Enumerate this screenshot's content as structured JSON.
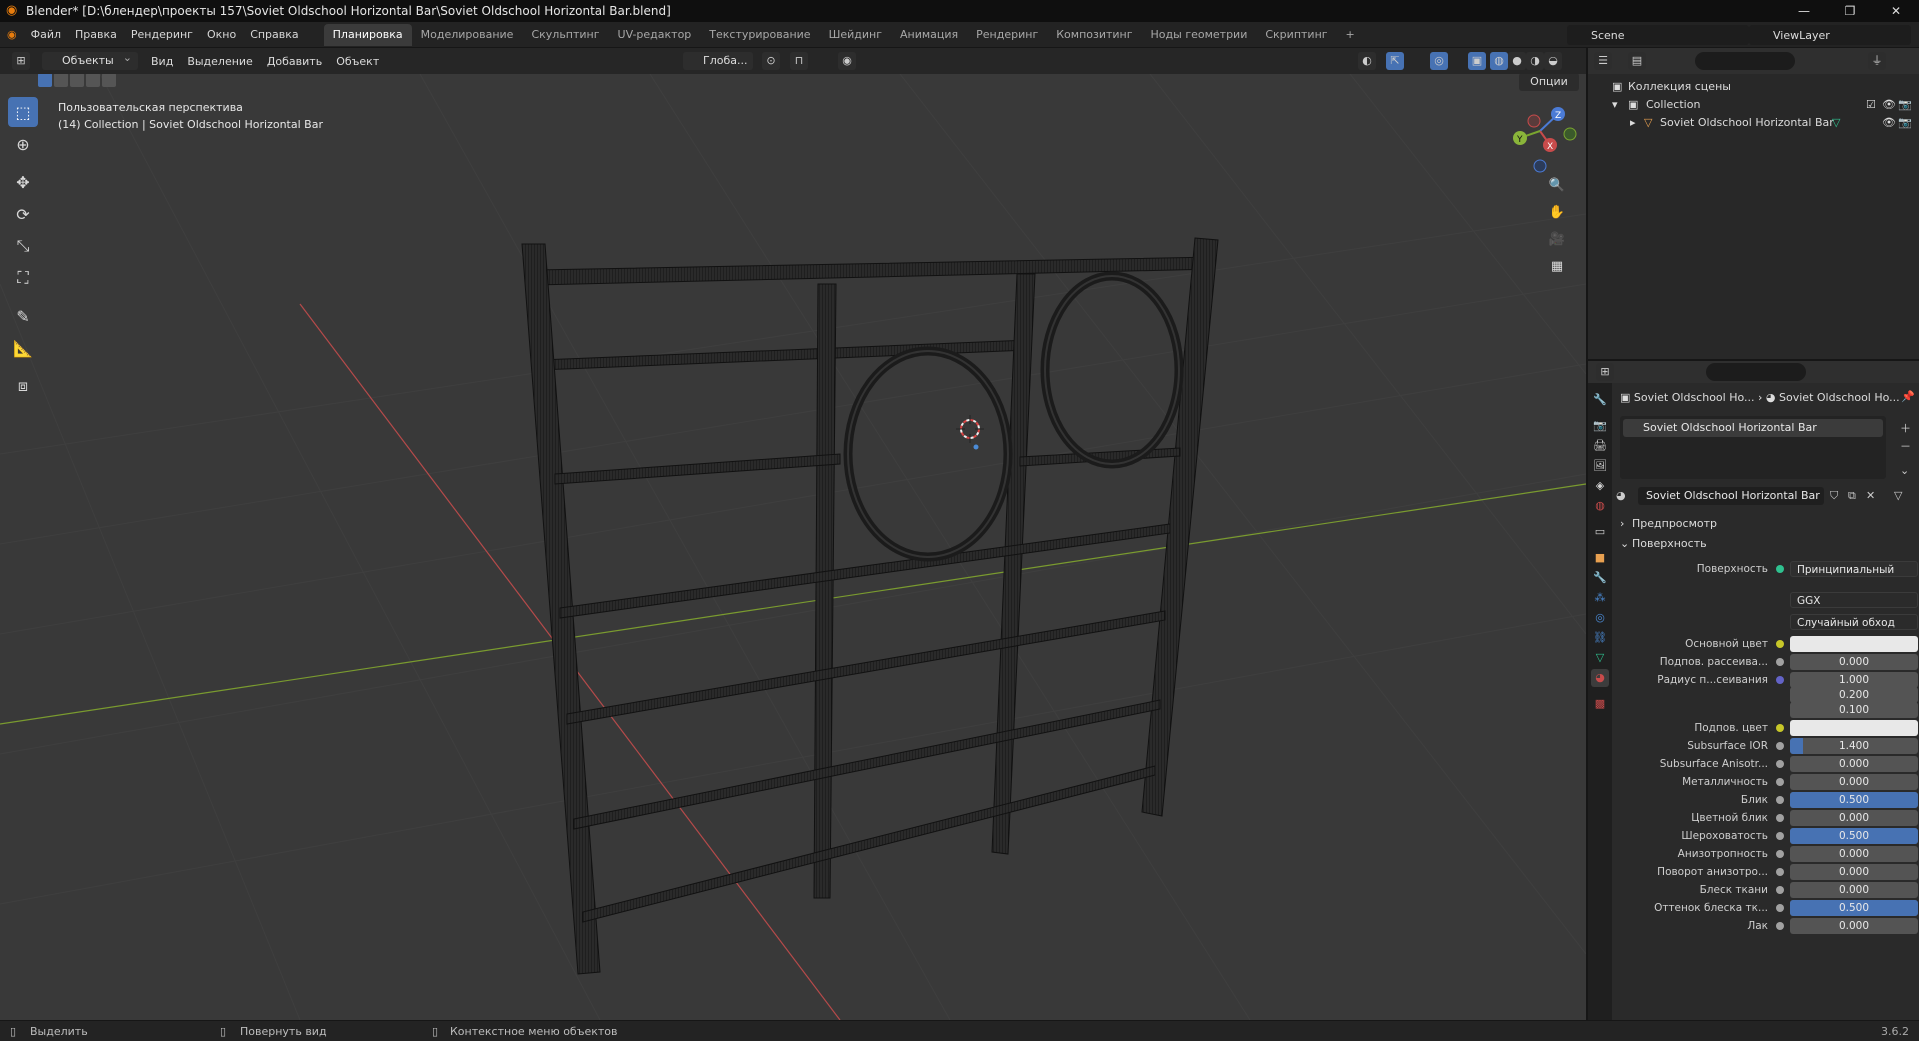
{
  "window": {
    "title": "Blender* [D:\\блендер\\проекты 157\\Soviet Oldschool Horizontal Bar\\Soviet Oldschool Horizontal Bar.blend]",
    "controls": [
      "—",
      "❐",
      "✕"
    ]
  },
  "menu": [
    "Файл",
    "Правка",
    "Рендеринг",
    "Окно",
    "Справка"
  ],
  "workspaces": [
    "Планировка",
    "Моделирование",
    "Скульптинг",
    "UV-редактор",
    "Текстурирование",
    "Шейдинг",
    "Анимация",
    "Рендеринг",
    "Композитинг",
    "Ноды геометрии",
    "Скриптинг",
    "+"
  ],
  "scene_name": "Scene",
  "view_layer": "ViewLayer",
  "viewport": {
    "mode": "Объекты",
    "menus": [
      "Вид",
      "Выделение",
      "Добавить",
      "Объект"
    ],
    "transform_orientation": "Глоба...",
    "perspective_label": "Пользовательская перспектива",
    "collection_label": "(14) Collection | Soviet Oldschool Horizontal Bar",
    "options_label": "Опции"
  },
  "outliner": {
    "root": "Коллекция сцены",
    "collection": "Collection",
    "object": "Soviet Oldschool Horizontal Bar"
  },
  "properties": {
    "breadcrumb_object": "Soviet Oldschool Ho...",
    "breadcrumb_material": "Soviet Oldschool Ho...",
    "slot": "Soviet Oldschool Horizontal Bar",
    "material": "Soviet Oldschool Horizontal Bar",
    "panel_preview": "Предпросмотр",
    "panel_surface": "Поверхность",
    "surface_label": "Поверхность",
    "surface_value": "Принципиальный BSDF",
    "distribution": "GGX",
    "subsurface_method": "Случайный обход",
    "rows": [
      {
        "label": "Основной цвет",
        "value": "",
        "type": "color",
        "dot": "#c7c729"
      },
      {
        "label": "Подпов. рассеива...",
        "value": "0.000",
        "type": "num",
        "fill": 0,
        "dot": "#a1a1a1"
      },
      {
        "label": "Радиус п...сеивания",
        "value": "1.000",
        "type": "num",
        "fill": 0,
        "dot": "#6363c7"
      },
      {
        "label": "",
        "value": "0.200",
        "type": "num",
        "fill": 0,
        "dot": ""
      },
      {
        "label": "",
        "value": "0.100",
        "type": "num",
        "fill": 0,
        "dot": ""
      },
      {
        "label": "Подпов. цвет",
        "value": "",
        "type": "color",
        "dot": "#c7c729"
      },
      {
        "label": "Subsurface IOR",
        "value": "1.400",
        "type": "num",
        "fill": 0.1,
        "dot": "#a1a1a1"
      },
      {
        "label": "Subsurface Anisotr...",
        "value": "0.000",
        "type": "num",
        "fill": 0,
        "dot": "#a1a1a1"
      },
      {
        "label": "Металличность",
        "value": "0.000",
        "type": "num",
        "fill": 0,
        "dot": "#a1a1a1"
      },
      {
        "label": "Блик",
        "value": "0.500",
        "type": "num",
        "fill": 1,
        "dot": "#a1a1a1"
      },
      {
        "label": "Цветной блик",
        "value": "0.000",
        "type": "num",
        "fill": 0,
        "dot": "#a1a1a1"
      },
      {
        "label": "Шероховатость",
        "value": "0.500",
        "type": "num",
        "fill": 1,
        "dot": "#a1a1a1"
      },
      {
        "label": "Анизотропность",
        "value": "0.000",
        "type": "num",
        "fill": 0,
        "dot": "#a1a1a1"
      },
      {
        "label": "Поворот анизотро...",
        "value": "0.000",
        "type": "num",
        "fill": 0,
        "dot": "#a1a1a1"
      },
      {
        "label": "Блеск ткани",
        "value": "0.000",
        "type": "num",
        "fill": 0,
        "dot": "#a1a1a1"
      },
      {
        "label": "Оттенок блеска тк...",
        "value": "0.500",
        "type": "num",
        "fill": 1,
        "dot": "#a1a1a1"
      },
      {
        "label": "Лак",
        "value": "0.000",
        "type": "num",
        "fill": 0,
        "dot": "#a1a1a1"
      }
    ]
  },
  "status": {
    "select": "Выделить",
    "rotate": "Повернуть вид",
    "context": "Контекстное меню объектов",
    "version": "3.6.2"
  },
  "gizmo": {
    "x": "X",
    "y": "Y",
    "z": "Z"
  },
  "colors": {
    "accent": "#4772b3",
    "x_axis": "#b54a4a",
    "y_axis": "#7a9b2f",
    "bg_viewport": "#393939"
  }
}
